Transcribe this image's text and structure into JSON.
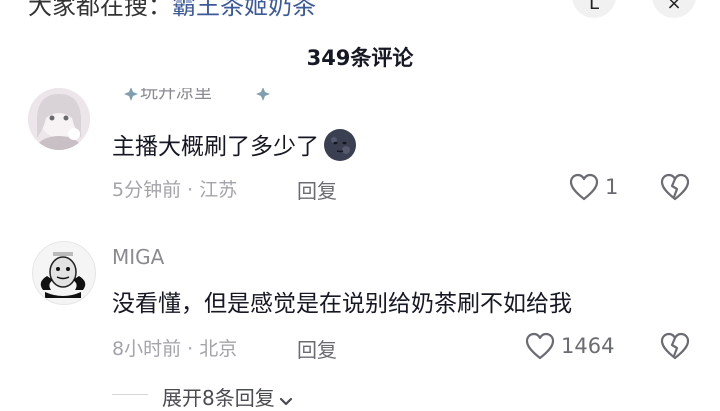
{
  "topbar": {
    "text_prefix": "大家都在搜：",
    "text_highlight": "霸王茶姬奶茶",
    "button1_label": "L",
    "button2_label": "×"
  },
  "comments_count": "349条评论",
  "comments": [
    {
      "username_partial": "玩开凉里",
      "text": "主播大概刷了多少了",
      "emoji": "moon-face-emoji",
      "time": "5分钟前",
      "location": "江苏",
      "reply_label": "回复",
      "likes": "1"
    },
    {
      "username": "MIGA",
      "text": "没看懂，但是感觉是在说别给奶茶刷不如给我",
      "time": "8小时前",
      "location": "北京",
      "reply_label": "回复",
      "likes": "1464"
    }
  ],
  "expand_replies": "展开8条回复",
  "colors": {
    "text": "#161823",
    "meta": "#a3a4a9",
    "icon": "#6b6c72",
    "link": "#3c5a9a"
  }
}
